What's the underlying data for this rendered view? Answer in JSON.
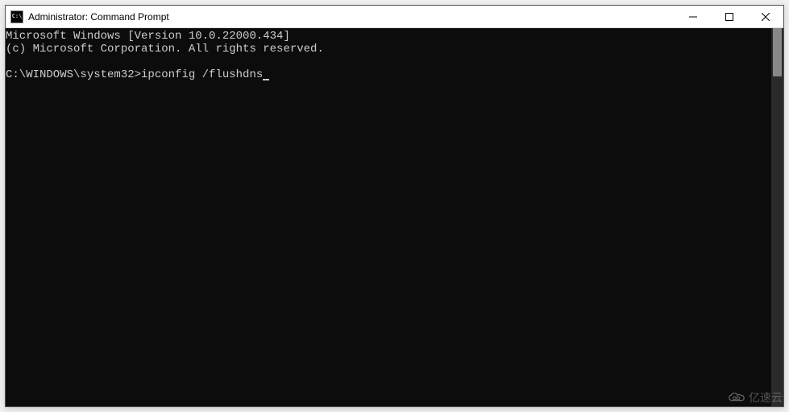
{
  "titlebar": {
    "icon_label": "C:\\",
    "title": "Administrator: Command Prompt"
  },
  "terminal": {
    "line1": "Microsoft Windows [Version 10.0.22000.434]",
    "line2": "(c) Microsoft Corporation. All rights reserved.",
    "blank": "",
    "prompt": "C:\\WINDOWS\\system32>",
    "command": "ipconfig /flushdns"
  },
  "watermark": {
    "text": "亿速云"
  }
}
